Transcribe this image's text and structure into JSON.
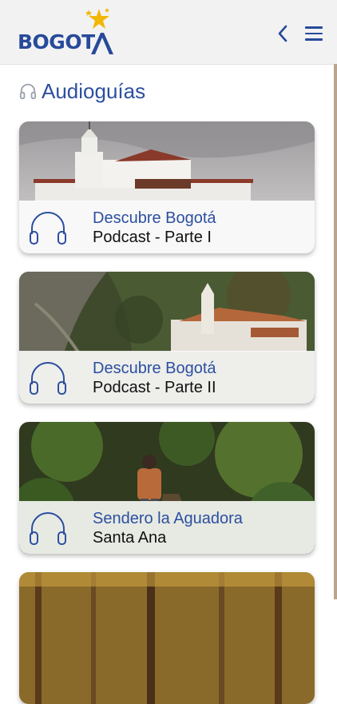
{
  "header": {
    "logo_text": "BOGOT",
    "back_icon": "chevron-left-icon",
    "menu_icon": "hamburger-menu-icon"
  },
  "section": {
    "title": "Audioguías",
    "icon": "headphones-icon"
  },
  "cards": [
    {
      "title": "Descubre Bogotá",
      "subtitle": "Podcast - Parte I"
    },
    {
      "title": "Descubre Bogotá",
      "subtitle": "Podcast - Parte II"
    },
    {
      "title": "Sendero la Aguadora",
      "subtitle": "Santa Ana"
    }
  ],
  "colors": {
    "brand_blue": "#274a9a",
    "title_blue": "#2c4fa0",
    "star_yellow": "#f2b705",
    "header_bg": "#f2f2f3"
  }
}
